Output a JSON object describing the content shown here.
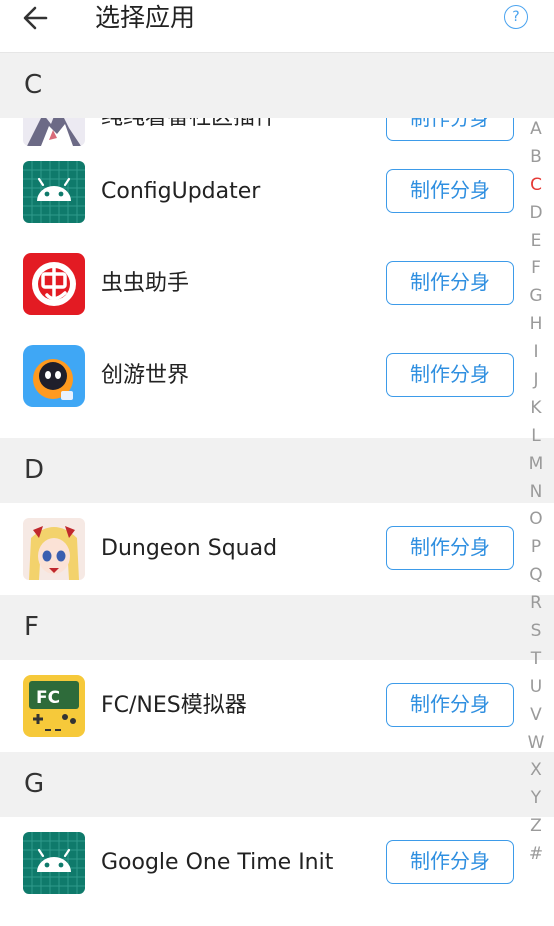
{
  "header": {
    "title": "选择应用",
    "help_label": "?"
  },
  "accent_color": "#3d9be9",
  "active_index_color": "#e53935",
  "sections": {
    "c": {
      "letter": "C",
      "apps": [
        {
          "name": "纯纯看番社区插件",
          "button": "制作分身",
          "icon": "anime-avatar-icon"
        },
        {
          "name": "ConfigUpdater",
          "button": "制作分身",
          "icon": "android-icon"
        },
        {
          "name": "虫虫助手",
          "button": "制作分身",
          "icon": "chongchong-icon"
        },
        {
          "name": "创游世界",
          "button": "制作分身",
          "icon": "chuangyou-icon"
        }
      ]
    },
    "d": {
      "letter": "D",
      "apps": [
        {
          "name": "Dungeon Squad",
          "button": "制作分身",
          "icon": "dungeon-squad-icon"
        }
      ]
    },
    "f": {
      "letter": "F",
      "apps": [
        {
          "name": "FC/NES模拟器",
          "button": "制作分身",
          "icon": "fc-nes-icon",
          "icon_text": "FC"
        }
      ]
    },
    "g": {
      "letter": "G",
      "apps": [
        {
          "name": "Google One Time Init",
          "button": "制作分身",
          "icon": "android-icon"
        }
      ]
    }
  },
  "index_bar": {
    "active": "C",
    "letters": [
      "A",
      "B",
      "C",
      "D",
      "E",
      "F",
      "G",
      "H",
      "I",
      "J",
      "K",
      "L",
      "M",
      "N",
      "O",
      "P",
      "Q",
      "R",
      "S",
      "T",
      "U",
      "V",
      "W",
      "X",
      "Y",
      "Z",
      "#"
    ]
  }
}
